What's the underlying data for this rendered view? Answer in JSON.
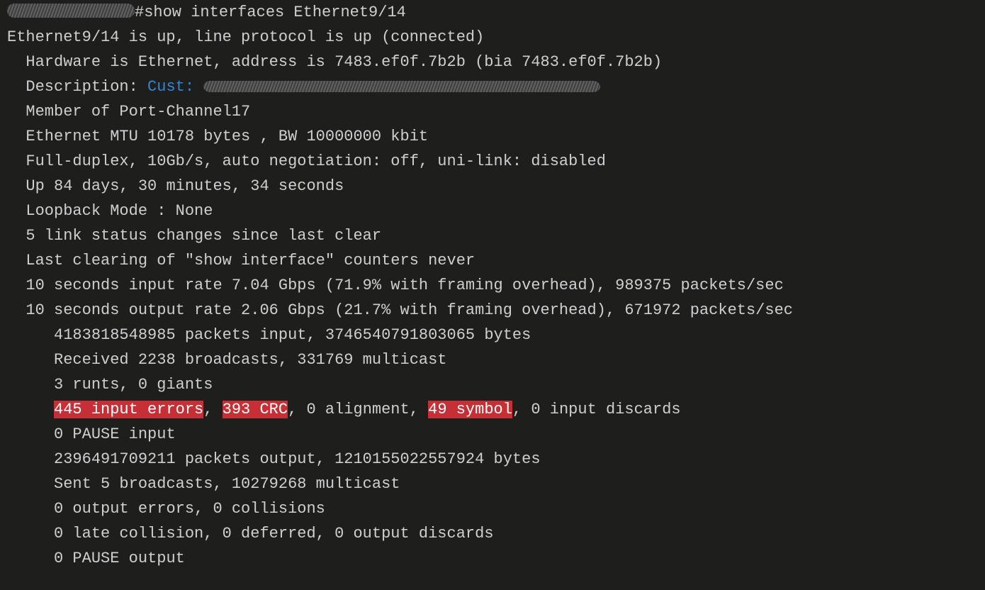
{
  "prompt": "#show interfaces Ethernet9/14",
  "status": "Ethernet9/14 is up, line protocol is up (connected)",
  "hardware": "Hardware is Ethernet, address is 7483.ef0f.7b2b (bia 7483.ef0f.7b2b)",
  "descLabel": "Description: ",
  "descCust": "Cust:",
  "member": "Member of Port-Channel17",
  "mtu": "Ethernet MTU 10178 bytes , BW 10000000 kbit",
  "duplex": "Full-duplex, 10Gb/s, auto negotiation: off, uni-link: disabled",
  "uptime": "Up 84 days, 30 minutes, 34 seconds",
  "loop": "Loopback Mode : None",
  "linkChanges": "5 link status changes since last clear",
  "lastClear": "Last clearing of \"show interface\" counters never",
  "inRate": "10 seconds input rate 7.04 Gbps (71.9% with framing overhead), 989375 packets/sec",
  "outRate": "10 seconds output rate 2.06 Gbps (21.7% with framing overhead), 671972 packets/sec",
  "pktsIn": "4183818548985 packets input, 3746540791803065 bytes",
  "broadcastsIn": "Received 2238 broadcasts, 331769 multicast",
  "runts": "3 runts, 0 giants",
  "err": {
    "inputErrors": "445 input errors",
    "crc": "393 CRC",
    "alignment": "0 alignment",
    "symbol": "49 symbol",
    "inputDiscards": "0 input discards"
  },
  "pauseIn": "0 PAUSE input",
  "pktsOut": "2396491709211 packets output, 1210155022557924 bytes",
  "broadcastsOut": "Sent 5 broadcasts, 10279268 multicast",
  "outErr": "0 output errors, 0 collisions",
  "lateColl": "0 late collision, 0 deferred, 0 output discards",
  "pauseOut": "0 PAUSE output"
}
